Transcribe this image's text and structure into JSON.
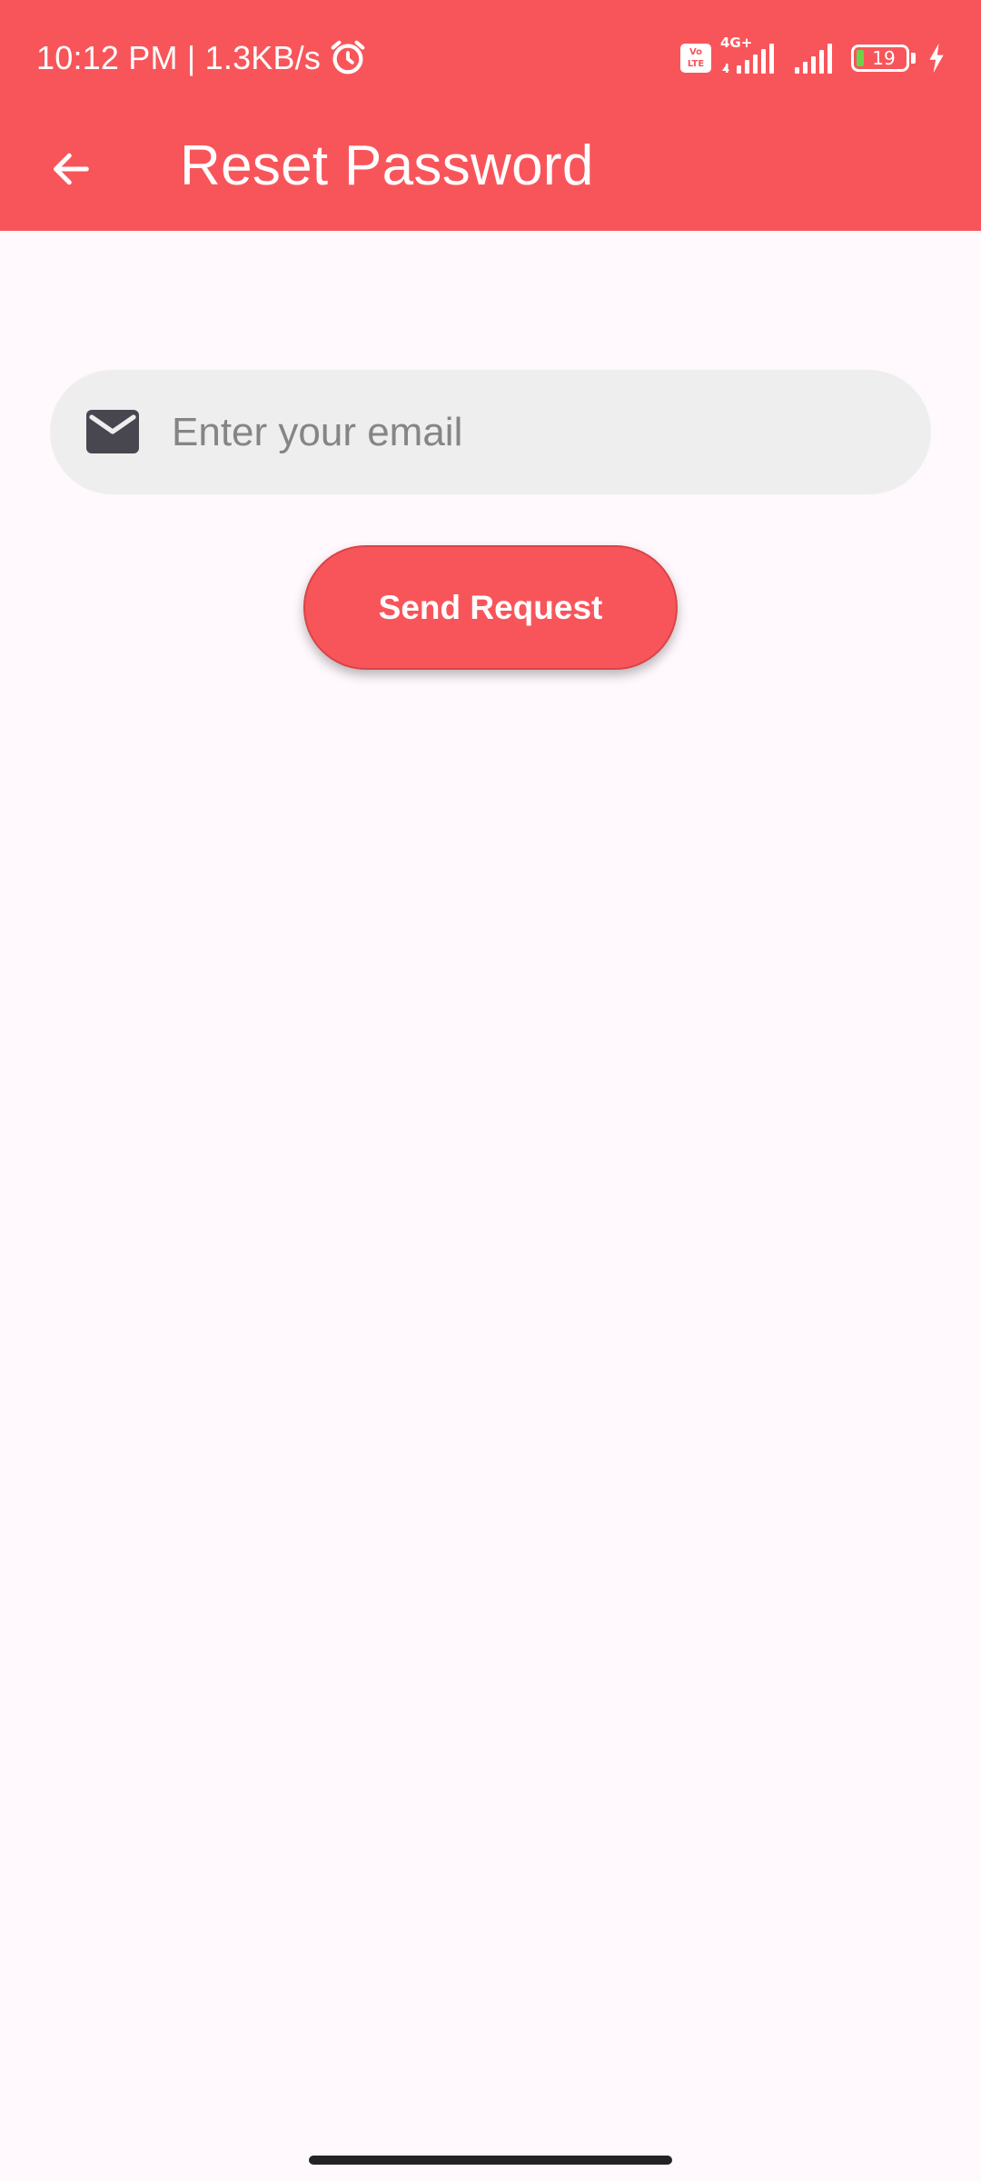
{
  "status_bar": {
    "time_speed": "10:12 PM | 1.3KB/s",
    "volte_top": "Vo",
    "volte_bottom": "LTE",
    "network_type": "4G+",
    "battery_level": "19",
    "icons": [
      "alarm-icon",
      "volte-icon",
      "signal-icon",
      "signal-icon",
      "battery-icon",
      "charging-icon"
    ]
  },
  "appbar": {
    "title": "Reset Password",
    "back_icon": "arrow-left-icon"
  },
  "form": {
    "email_placeholder": "Enter your email",
    "email_value": "",
    "email_icon": "mail-icon",
    "submit_label": "Send Request"
  },
  "colors": {
    "primary": "#f8555a",
    "background": "#fff8fc",
    "field_background": "#eeeeee",
    "placeholder": "#858585"
  }
}
